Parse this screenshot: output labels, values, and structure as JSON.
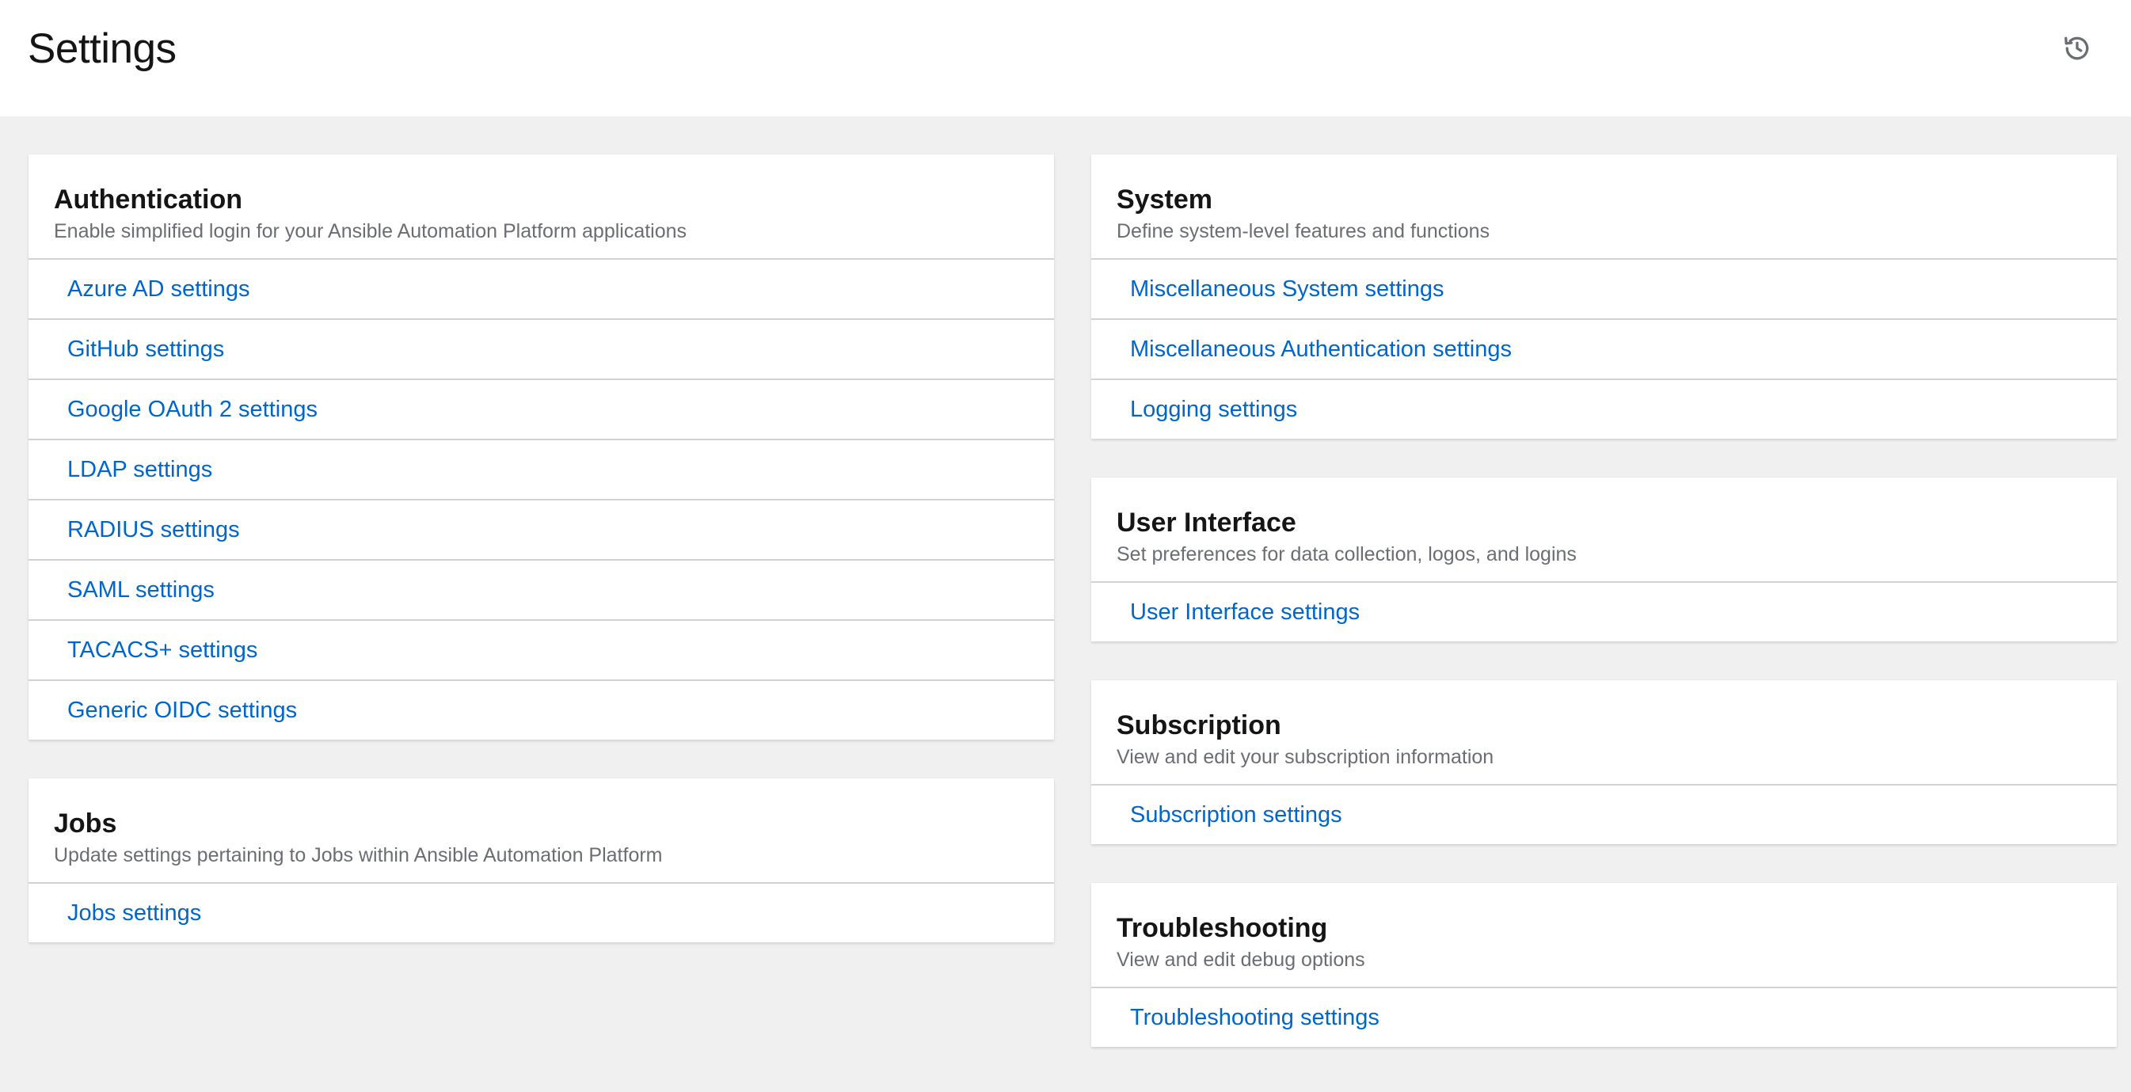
{
  "header": {
    "title": "Settings",
    "history_icon": "history-icon"
  },
  "left_column": [
    {
      "id": "authentication",
      "title": "Authentication",
      "description": "Enable simplified login for your Ansible Automation Platform applications",
      "links": [
        "Azure AD settings",
        "GitHub settings",
        "Google OAuth 2 settings",
        "LDAP settings",
        "RADIUS settings",
        "SAML settings",
        "TACACS+ settings",
        "Generic OIDC settings"
      ]
    },
    {
      "id": "jobs",
      "title": "Jobs",
      "description": "Update settings pertaining to Jobs within Ansible Automation Platform",
      "links": [
        "Jobs settings"
      ]
    }
  ],
  "right_column": [
    {
      "id": "system",
      "title": "System",
      "description": "Define system-level features and functions",
      "links": [
        "Miscellaneous System settings",
        "Miscellaneous Authentication settings",
        "Logging settings"
      ]
    },
    {
      "id": "user-interface",
      "title": "User Interface",
      "description": "Set preferences for data collection, logos, and logins",
      "links": [
        "User Interface settings"
      ]
    },
    {
      "id": "subscription",
      "title": "Subscription",
      "description": "View and edit your subscription information",
      "links": [
        "Subscription settings"
      ]
    },
    {
      "id": "troubleshooting",
      "title": "Troubleshooting",
      "description": "View and edit debug options",
      "links": [
        "Troubleshooting settings"
      ]
    }
  ],
  "colors": {
    "link": "#0066cc",
    "background": "#f0f0f0",
    "card": "#ffffff",
    "divider": "#d2d2d2",
    "muted_text": "#6a6e73"
  }
}
